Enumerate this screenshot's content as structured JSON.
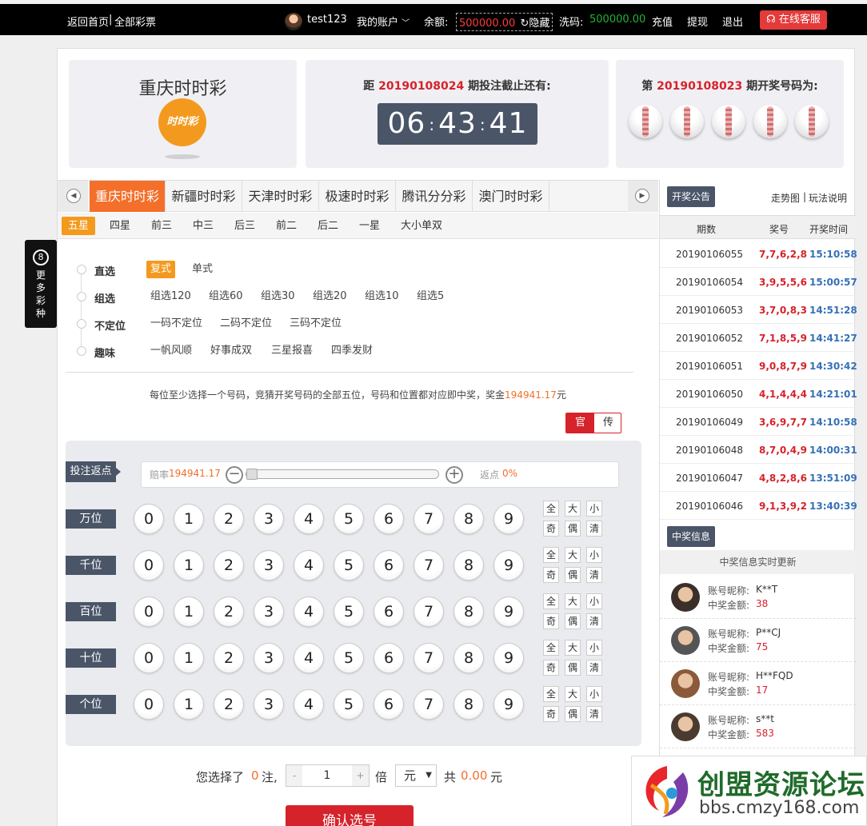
{
  "topbar": {
    "home": "返回首页",
    "divider": "|",
    "all_lottery": "全部彩票",
    "username": "test123",
    "my_account": "我的账户",
    "balance_label": "余额:",
    "balance_value": "500000.00",
    "hide_label": "隐藏",
    "wash_label": "洗码:",
    "wash_value": "500000.00",
    "recharge": "充值",
    "withdraw": "提现",
    "logout": "退出",
    "service": "在线客服"
  },
  "header": {
    "game_title": "重庆时时彩",
    "logo_text": "时时彩",
    "countdown_prefix": "距",
    "countdown_issue": "20190108024",
    "countdown_suffix": "期投注截止还有:",
    "timer_h": "06",
    "timer_m": "43",
    "timer_s": "41",
    "colon": ":",
    "last_prefix": "第",
    "last_issue": "20190108023",
    "last_suffix": "期开奖号码为:"
  },
  "tabs": [
    "重庆时时彩",
    "新疆时时彩",
    "天津时时彩",
    "极速时时彩",
    "腾讯分分彩",
    "澳门时时彩"
  ],
  "subtabs": [
    "五星",
    "四星",
    "前三",
    "中三",
    "后三",
    "前二",
    "后二",
    "一星",
    "大小单双"
  ],
  "play_groups": [
    {
      "label": "直选",
      "options": [
        "复式",
        "单式"
      ]
    },
    {
      "label": "组选",
      "options": [
        "组选120",
        "组选60",
        "组选30",
        "组选20",
        "组选10",
        "组选5"
      ]
    },
    {
      "label": "不定位",
      "options": [
        "一码不定位",
        "二码不定位",
        "三码不定位"
      ]
    },
    {
      "label": "趣味",
      "options": [
        "一帆风顺",
        "好事成双",
        "三星报喜",
        "四季发财"
      ]
    }
  ],
  "description": {
    "text": "每位至少选择一个号码，竞猜开奖号码的全部五位，号码和位置都对应即中奖，奖金",
    "prize": "194941.17",
    "unit": "元"
  },
  "toggle": {
    "official": "官",
    "traditional": "传"
  },
  "rebate": {
    "tag": "投注返点",
    "odds_label": "赔率",
    "odds_value": "194941.17",
    "minus": "−",
    "plus": "+",
    "rebate_label": "返点",
    "rebate_value": "0%",
    "slider_level": 0
  },
  "positions": [
    "万位",
    "千位",
    "百位",
    "十位",
    "个位"
  ],
  "digits": [
    "0",
    "1",
    "2",
    "3",
    "4",
    "5",
    "6",
    "7",
    "8",
    "9"
  ],
  "quick": [
    "全",
    "大",
    "小",
    "奇",
    "偶",
    "清"
  ],
  "bottom": {
    "selected_prefix": "您选择了",
    "selected_count": "0",
    "selected_unit": "注,",
    "minus": "-",
    "multiple": "1",
    "plus": "+",
    "times": "倍",
    "currency": "元",
    "total_prefix": "共",
    "total_value": "0.00",
    "total_unit": "元",
    "confirm": "确认选号"
  },
  "announce": {
    "tag": "开奖公告",
    "trend": "走势图",
    "sep": "|",
    "rules": "玩法说明",
    "headers": [
      "期数",
      "奖号",
      "开奖时间"
    ],
    "rows": [
      {
        "issue": "20190106055",
        "code": "7,7,6,2,8",
        "time": "15:10:58"
      },
      {
        "issue": "20190106054",
        "code": "3,9,5,5,6",
        "time": "15:00:57"
      },
      {
        "issue": "20190106053",
        "code": "3,7,0,8,3",
        "time": "14:51:28"
      },
      {
        "issue": "20190106052",
        "code": "7,1,8,5,9",
        "time": "14:41:27"
      },
      {
        "issue": "20190106051",
        "code": "9,0,8,7,9",
        "time": "14:30:42"
      },
      {
        "issue": "20190106050",
        "code": "4,1,4,4,4",
        "time": "14:21:01"
      },
      {
        "issue": "20190106049",
        "code": "3,6,9,7,7",
        "time": "14:10:58"
      },
      {
        "issue": "20190106048",
        "code": "8,7,0,4,9",
        "time": "14:00:31"
      },
      {
        "issue": "20190106047",
        "code": "4,8,2,8,6",
        "time": "13:51:09"
      },
      {
        "issue": "20190106046",
        "code": "9,1,3,9,2",
        "time": "13:40:39"
      }
    ]
  },
  "winners": {
    "tag": "中奖信息",
    "subtitle": "中奖信息实时更新",
    "name_label": "账号昵称:",
    "amount_label": "中奖金额:",
    "rows": [
      {
        "name": "K**T",
        "amount": "38"
      },
      {
        "name": "P**CJ",
        "amount": "75"
      },
      {
        "name": "H**FQD",
        "amount": "17"
      },
      {
        "name": "s**t",
        "amount": "583"
      }
    ]
  },
  "side": {
    "badge": "8",
    "label": "更多彩种"
  },
  "watermark": {
    "title": "创盟资源论坛",
    "url": "bbs.cmzy168.com"
  },
  "colors": {
    "accent": "#f36f2a",
    "red": "#d6222b",
    "dark": "#4a5568",
    "blue_time": "#3570b8"
  }
}
